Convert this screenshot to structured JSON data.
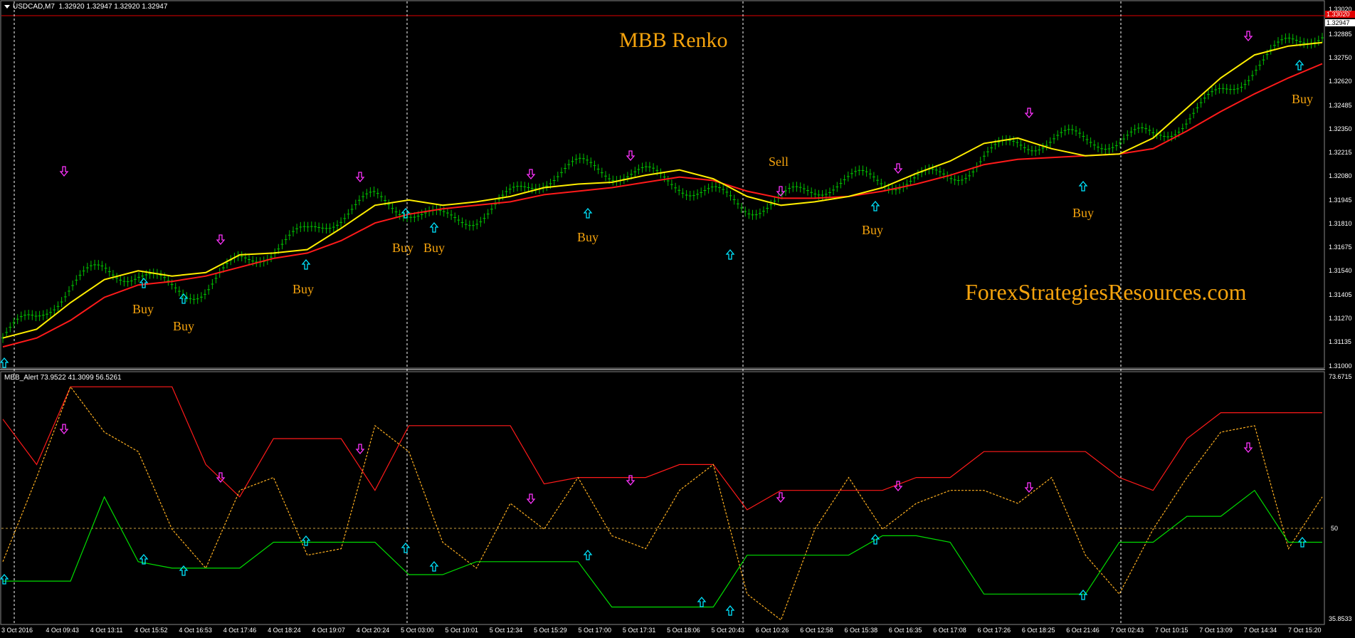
{
  "main_header": "USDCAD,M7  1.32920 1.32947 1.32920 1.32947",
  "sub_header": "MBB_Alert 73.9522 41.3099 56.5261",
  "title": "MBB Renko",
  "watermark": "ForexStrategiesResources.com",
  "colors": {
    "background": "#000000",
    "bullish_brick": "#00c000",
    "yellow_ma": "#ffee00",
    "red_ma": "#ff1a1a",
    "buy_arrow": "#00e5ff",
    "sell_arrow": "#ff33ff",
    "label": "#f5a30d",
    "grid_dashed": "#ffffff"
  },
  "price_axis": {
    "labels": [
      "1.33020",
      "1.32947",
      "1.32885",
      "1.32750",
      "1.32620",
      "1.32485",
      "1.32350",
      "1.32215",
      "1.32080",
      "1.31945",
      "1.31810",
      "1.31675",
      "1.31540",
      "1.31405",
      "1.31270",
      "1.31135",
      "1.31000"
    ],
    "current_price": "1.32947",
    "top_marker": "1.33020"
  },
  "indicator_axis": {
    "labels": [
      "73.6715",
      "50",
      "35.8533"
    ]
  },
  "time_axis": {
    "labels": [
      "3 Oct 2016",
      "4 Oct 09:43",
      "4 Oct 13:11",
      "4 Oct 15:52",
      "4 Oct 16:53",
      "4 Oct 17:46",
      "4 Oct 18:24",
      "4 Oct 19:07",
      "4 Oct 20:24",
      "5 Oct 03:00",
      "5 Oct 10:01",
      "5 Oct 12:34",
      "5 Oct 15:29",
      "5 Oct 17:00",
      "5 Oct 17:31",
      "5 Oct 18:06",
      "5 Oct 20:43",
      "6 Oct 10:26",
      "6 Oct 12:58",
      "6 Oct 15:38",
      "6 Oct 16:35",
      "6 Oct 17:08",
      "6 Oct 17:26",
      "6 Oct 18:25",
      "6 Oct 21:46",
      "7 Oct 02:43",
      "7 Oct 10:15",
      "7 Oct 13:09",
      "7 Oct 14:34",
      "7 Oct 15:20"
    ]
  },
  "signals": [
    {
      "text": "Buy"
    },
    {
      "text": "Buy"
    },
    {
      "text": "Buy"
    },
    {
      "text": "Buy"
    },
    {
      "text": "Buy"
    },
    {
      "text": "Buy"
    },
    {
      "text": "Sell"
    },
    {
      "text": "Buy"
    },
    {
      "text": "Buy"
    },
    {
      "text": "Buy"
    }
  ],
  "chart_data": {
    "type": "line",
    "main_series": [
      {
        "name": "yellow MA",
        "values": [
          1.3115,
          1.312,
          1.3135,
          1.3148,
          1.3153,
          1.315,
          1.3152,
          1.3162,
          1.3163,
          1.3165,
          1.3177,
          1.319,
          1.3193,
          1.319,
          1.3192,
          1.3195,
          1.32,
          1.3202,
          1.3203,
          1.3207,
          1.321,
          1.3205,
          1.3195,
          1.319,
          1.3192,
          1.3195,
          1.32,
          1.3208,
          1.3215,
          1.3225,
          1.3228,
          1.3222,
          1.3218,
          1.3219,
          1.3228,
          1.3245,
          1.3262,
          1.3275,
          1.328,
          1.3282
        ]
      },
      {
        "name": "red MA",
        "values": [
          1.311,
          1.3115,
          1.3125,
          1.3138,
          1.3145,
          1.3147,
          1.315,
          1.3155,
          1.316,
          1.3163,
          1.317,
          1.318,
          1.3185,
          1.3188,
          1.319,
          1.3192,
          1.3196,
          1.3198,
          1.32,
          1.3203,
          1.3206,
          1.3204,
          1.3198,
          1.3194,
          1.3194,
          1.3195,
          1.3198,
          1.3202,
          1.3207,
          1.3213,
          1.3216,
          1.3217,
          1.3218,
          1.3219,
          1.3222,
          1.3232,
          1.3243,
          1.3253,
          1.3262,
          1.327
        ]
      }
    ],
    "indicator_series": [
      {
        "name": "red line",
        "values": [
          67,
          60,
          72,
          72,
          72,
          72,
          60,
          55,
          64,
          64,
          64,
          56,
          66,
          66,
          66,
          66,
          57,
          58,
          58,
          58,
          60,
          60,
          53,
          56,
          56,
          56,
          56,
          58,
          58,
          62,
          62,
          62,
          62,
          58,
          56,
          64,
          68,
          68,
          68,
          68
        ]
      },
      {
        "name": "dotted line",
        "values": [
          45,
          58,
          72,
          65,
          62,
          50,
          44,
          56,
          58,
          46,
          47,
          66,
          62,
          48,
          44,
          54,
          50,
          58,
          49,
          47,
          56,
          60,
          40,
          36,
          50,
          58,
          50,
          54,
          56,
          56,
          54,
          58,
          46,
          40,
          50,
          58,
          65,
          66,
          47,
          55
        ]
      },
      {
        "name": "green line",
        "values": [
          42,
          42,
          42,
          55,
          45,
          44,
          44,
          44,
          48,
          48,
          48,
          48,
          43,
          43,
          45,
          45,
          45,
          45,
          38,
          38,
          38,
          38,
          46,
          46,
          46,
          46,
          49,
          49,
          48,
          40,
          40,
          40,
          40,
          48,
          48,
          52,
          52,
          56,
          48,
          48
        ]
      }
    ],
    "ylim_main": [
      1.31,
      1.3302
    ],
    "ylim_indicator": [
      35.8533,
      73.6715
    ]
  }
}
